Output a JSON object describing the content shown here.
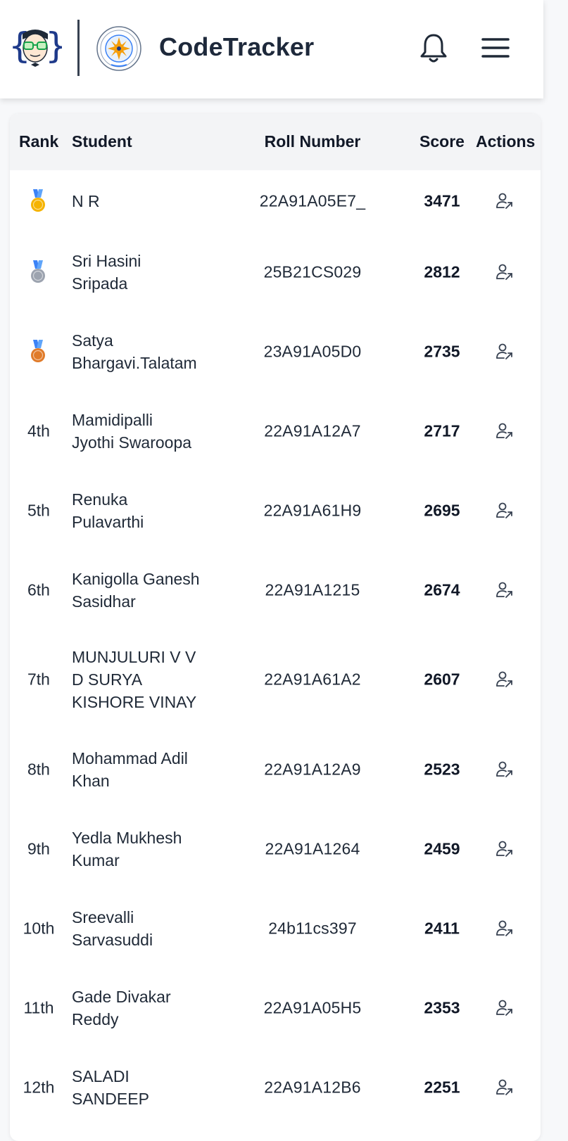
{
  "header": {
    "title": "CodeTracker",
    "icons": {
      "logo": "coder-face-logo",
      "college_logo": "college-emblem-logo",
      "notifications": "bell-icon",
      "menu": "hamburger-menu-icon"
    }
  },
  "table": {
    "columns": {
      "rank": "Rank",
      "student": "Student",
      "roll": "Roll Number",
      "score": "Score",
      "actions": "Actions"
    },
    "medal_colors": {
      "gold": "#f5b301",
      "silver": "#9ca3af",
      "bronze": "#e07b2a",
      "ribbon_blue": "#3b82f6"
    },
    "action_icon": "view-profile-icon",
    "rows": [
      {
        "rank": "",
        "medal": "gold",
        "student": [
          "N R"
        ],
        "roll": "22A91A05E7_",
        "score": "3471"
      },
      {
        "rank": "",
        "medal": "silver",
        "student": [
          "Sri Hasini",
          "Sripada"
        ],
        "roll": "25B21CS029",
        "score": "2812"
      },
      {
        "rank": "",
        "medal": "bronze",
        "student": [
          "Satya",
          "Bhargavi.Talatam"
        ],
        "roll": "23A91A05D0",
        "score": "2735"
      },
      {
        "rank": "4th",
        "medal": "",
        "student": [
          "Mamidipalli",
          "Jyothi Swaroopa"
        ],
        "roll": "22A91A12A7",
        "score": "2717"
      },
      {
        "rank": "5th",
        "medal": "",
        "student": [
          "Renuka",
          "Pulavarthi"
        ],
        "roll": "22A91A61H9",
        "score": "2695"
      },
      {
        "rank": "6th",
        "medal": "",
        "student": [
          "Kanigolla Ganesh",
          "Sasidhar"
        ],
        "roll": "22A91A1215",
        "score": "2674"
      },
      {
        "rank": "7th",
        "medal": "",
        "student": [
          "MUNJULURI V V",
          "D SURYA",
          "KISHORE VINAY"
        ],
        "roll": "22A91A61A2",
        "score": "2607"
      },
      {
        "rank": "8th",
        "medal": "",
        "student": [
          "Mohammad Adil",
          "Khan"
        ],
        "roll": "22A91A12A9",
        "score": "2523"
      },
      {
        "rank": "9th",
        "medal": "",
        "student": [
          "Yedla Mukhesh",
          "Kumar"
        ],
        "roll": "22A91A1264",
        "score": "2459"
      },
      {
        "rank": "10th",
        "medal": "",
        "student": [
          "Sreevalli",
          "Sarvasuddi"
        ],
        "roll": "24b11cs397",
        "score": "2411"
      },
      {
        "rank": "11th",
        "medal": "",
        "student": [
          "Gade Divakar",
          "Reddy"
        ],
        "roll": "22A91A05H5",
        "score": "2353"
      },
      {
        "rank": "12th",
        "medal": "",
        "student": [
          "SALADI",
          "SANDEEP"
        ],
        "roll": "22A91A12B6",
        "score": "2251"
      }
    ]
  }
}
